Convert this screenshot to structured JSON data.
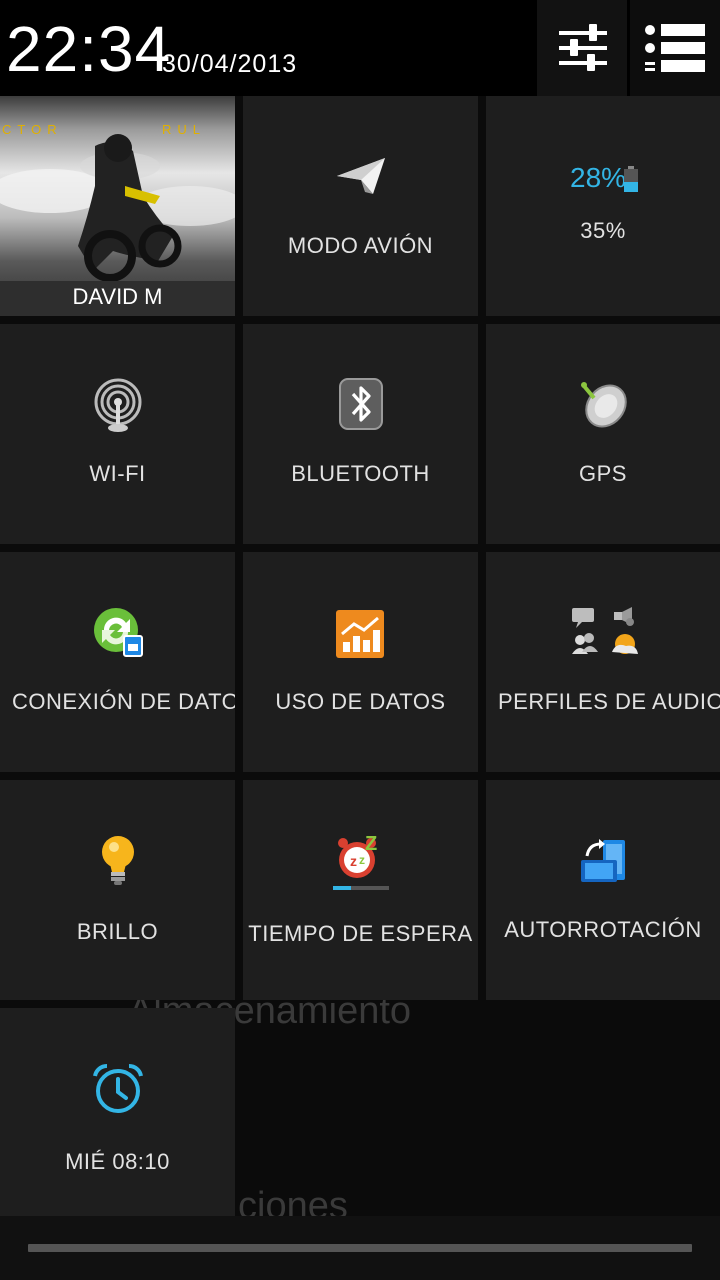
{
  "header": {
    "time": "22:34",
    "date": "30/04/2013"
  },
  "background_text": {
    "line1": "Almacenamiento",
    "line2": "ciones"
  },
  "tiles": {
    "user": {
      "name": "DAVID M",
      "photo_caption_left": "CTOR",
      "photo_caption_right": "RUL"
    },
    "airplane": {
      "label": "MODO AVIÓN",
      "icon": "paper-plane-icon"
    },
    "battery": {
      "percent_text": "28%",
      "label": "35%",
      "icon": "battery-icon",
      "accent": "#33b5e5"
    },
    "wifi": {
      "label": "WI-FI",
      "icon": "wifi-antenna-icon"
    },
    "bluetooth": {
      "label": "BLUETOOTH",
      "icon": "bluetooth-icon"
    },
    "gps": {
      "label": "GPS",
      "icon": "satellite-dish-icon"
    },
    "data": {
      "label": "CONEXIÓN DE DATOS",
      "icon": "data-connection-icon"
    },
    "data_usage": {
      "label": "USO DE DATOS",
      "icon": "data-usage-chart-icon"
    },
    "audio": {
      "label": "PERFILES DE AUDIO",
      "icon": "audio-profiles-icon"
    },
    "brightness": {
      "label": "BRILLO",
      "icon": "light-bulb-icon"
    },
    "timeout": {
      "label": "TIEMPO DE ESPERA",
      "icon": "sleep-timer-icon"
    },
    "rotation": {
      "label": "AUTORROTACIÓN",
      "icon": "auto-rotate-icon",
      "accent": "#1e88e5"
    },
    "alarm": {
      "label": "MIÉ 08:10",
      "icon": "alarm-clock-icon",
      "accent": "#33b5e5"
    }
  }
}
